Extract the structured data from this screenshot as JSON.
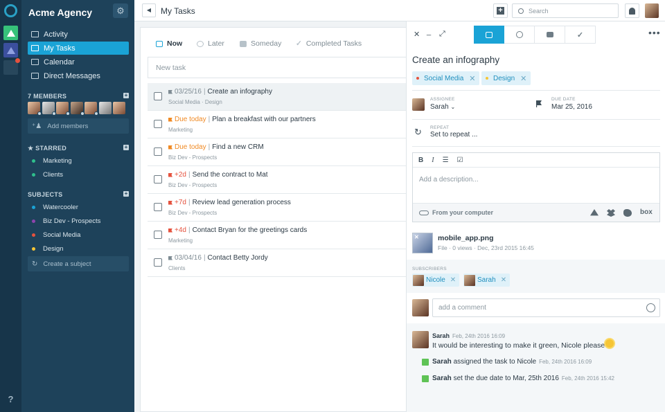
{
  "app": {
    "workspace_name": "Acme Agency",
    "help_label": "?"
  },
  "sidebar": {
    "nav": [
      {
        "label": "Activity",
        "icon": "activity-icon"
      },
      {
        "label": "My Tasks",
        "icon": "tasks-icon",
        "active": true
      },
      {
        "label": "Calendar",
        "icon": "calendar-icon"
      },
      {
        "label": "Direct Messages",
        "icon": "messages-icon"
      }
    ],
    "members_title": "7 MEMBERS",
    "add_members": "Add members",
    "starred_title": "★ STARRED",
    "starred": [
      {
        "label": "Marketing",
        "color": "#2fbf8c"
      },
      {
        "label": "Clients",
        "color": "#2fbf8c"
      }
    ],
    "subjects_title": "SUBJECTS",
    "subjects": [
      {
        "label": "Watercooler",
        "color": "#1aa3d6"
      },
      {
        "label": "Biz Dev - Prospects",
        "color": "#8e44ad"
      },
      {
        "label": "Social Media",
        "color": "#e5523e"
      },
      {
        "label": "Design",
        "color": "#f6c535"
      }
    ],
    "create_subject": "Create a subject"
  },
  "topbar": {
    "title": "My Tasks",
    "search_placeholder": "Search"
  },
  "tasks": {
    "tabs": [
      {
        "label": "Now",
        "active": true
      },
      {
        "label": "Later"
      },
      {
        "label": "Someday"
      },
      {
        "label": "Completed Tasks"
      }
    ],
    "new_task_placeholder": "New task",
    "items": [
      {
        "due": "03/25/16",
        "title": "Create an infography",
        "meta": "Social Media · Design"
      },
      {
        "due": "Due today",
        "title": "Plan a breakfast with our partners",
        "meta": "Marketing"
      },
      {
        "due": "Due today",
        "title": "Find a new CRM",
        "meta": "Biz Dev - Prospects"
      },
      {
        "due": "+2d",
        "title": "Send the contract to Mat",
        "meta": "Biz Dev - Prospects"
      },
      {
        "due": "+7d",
        "title": "Review lead generation process",
        "meta": "Biz Dev - Prospects"
      },
      {
        "due": "+4d",
        "title": "Contact Bryan for the greetings cards",
        "meta": "Marketing"
      },
      {
        "due": "03/04/16",
        "title": "Contact Betty Jordy",
        "meta": "Clients"
      }
    ],
    "separator": "|"
  },
  "detail": {
    "title": "Create an infography",
    "tags": [
      {
        "label": "Social Media",
        "color": "#e5523e"
      },
      {
        "label": "Design",
        "color": "#f6c535"
      }
    ],
    "assignee_label": "ASSIGNEE",
    "assignee": "Sarah",
    "due_label": "DUE DATE",
    "due_date": "Mar 25, 2016",
    "repeat_label": "REPEAT",
    "repeat_value": "Set to repeat ...",
    "editor": {
      "bold": "B",
      "italic": "I",
      "placeholder": "Add a description...",
      "from_computer": "From your computer",
      "box_label": "box"
    },
    "file": {
      "name": "mobile_app.png",
      "meta": "File · 0 views · Dec, 23rd 2015 16:45"
    },
    "subscribers_label": "SUBSCRIBERS",
    "subscribers": [
      "Nicole",
      "Sarah"
    ],
    "comment_placeholder": "add a comment",
    "activity": {
      "comment_author": "Sarah",
      "comment_time": "Feb, 24th 2016 16:09",
      "comment_text": "It would be interesting to make it green, Nicole please !",
      "events": [
        {
          "actor": "Sarah",
          "text": "assigned the task to Nicole",
          "time": "Feb, 24th 2016 16:09"
        },
        {
          "actor": "Sarah",
          "text": "set the due date to Mar, 25th 2016",
          "time": "Feb, 24th 2016 15:42"
        }
      ]
    }
  },
  "colors": {
    "accent": "#1aa3d6",
    "sidebar_bg": "#1e425a",
    "rail_bg": "#17354a",
    "due_today": "#f08a24",
    "overdue": "#e5523e"
  }
}
